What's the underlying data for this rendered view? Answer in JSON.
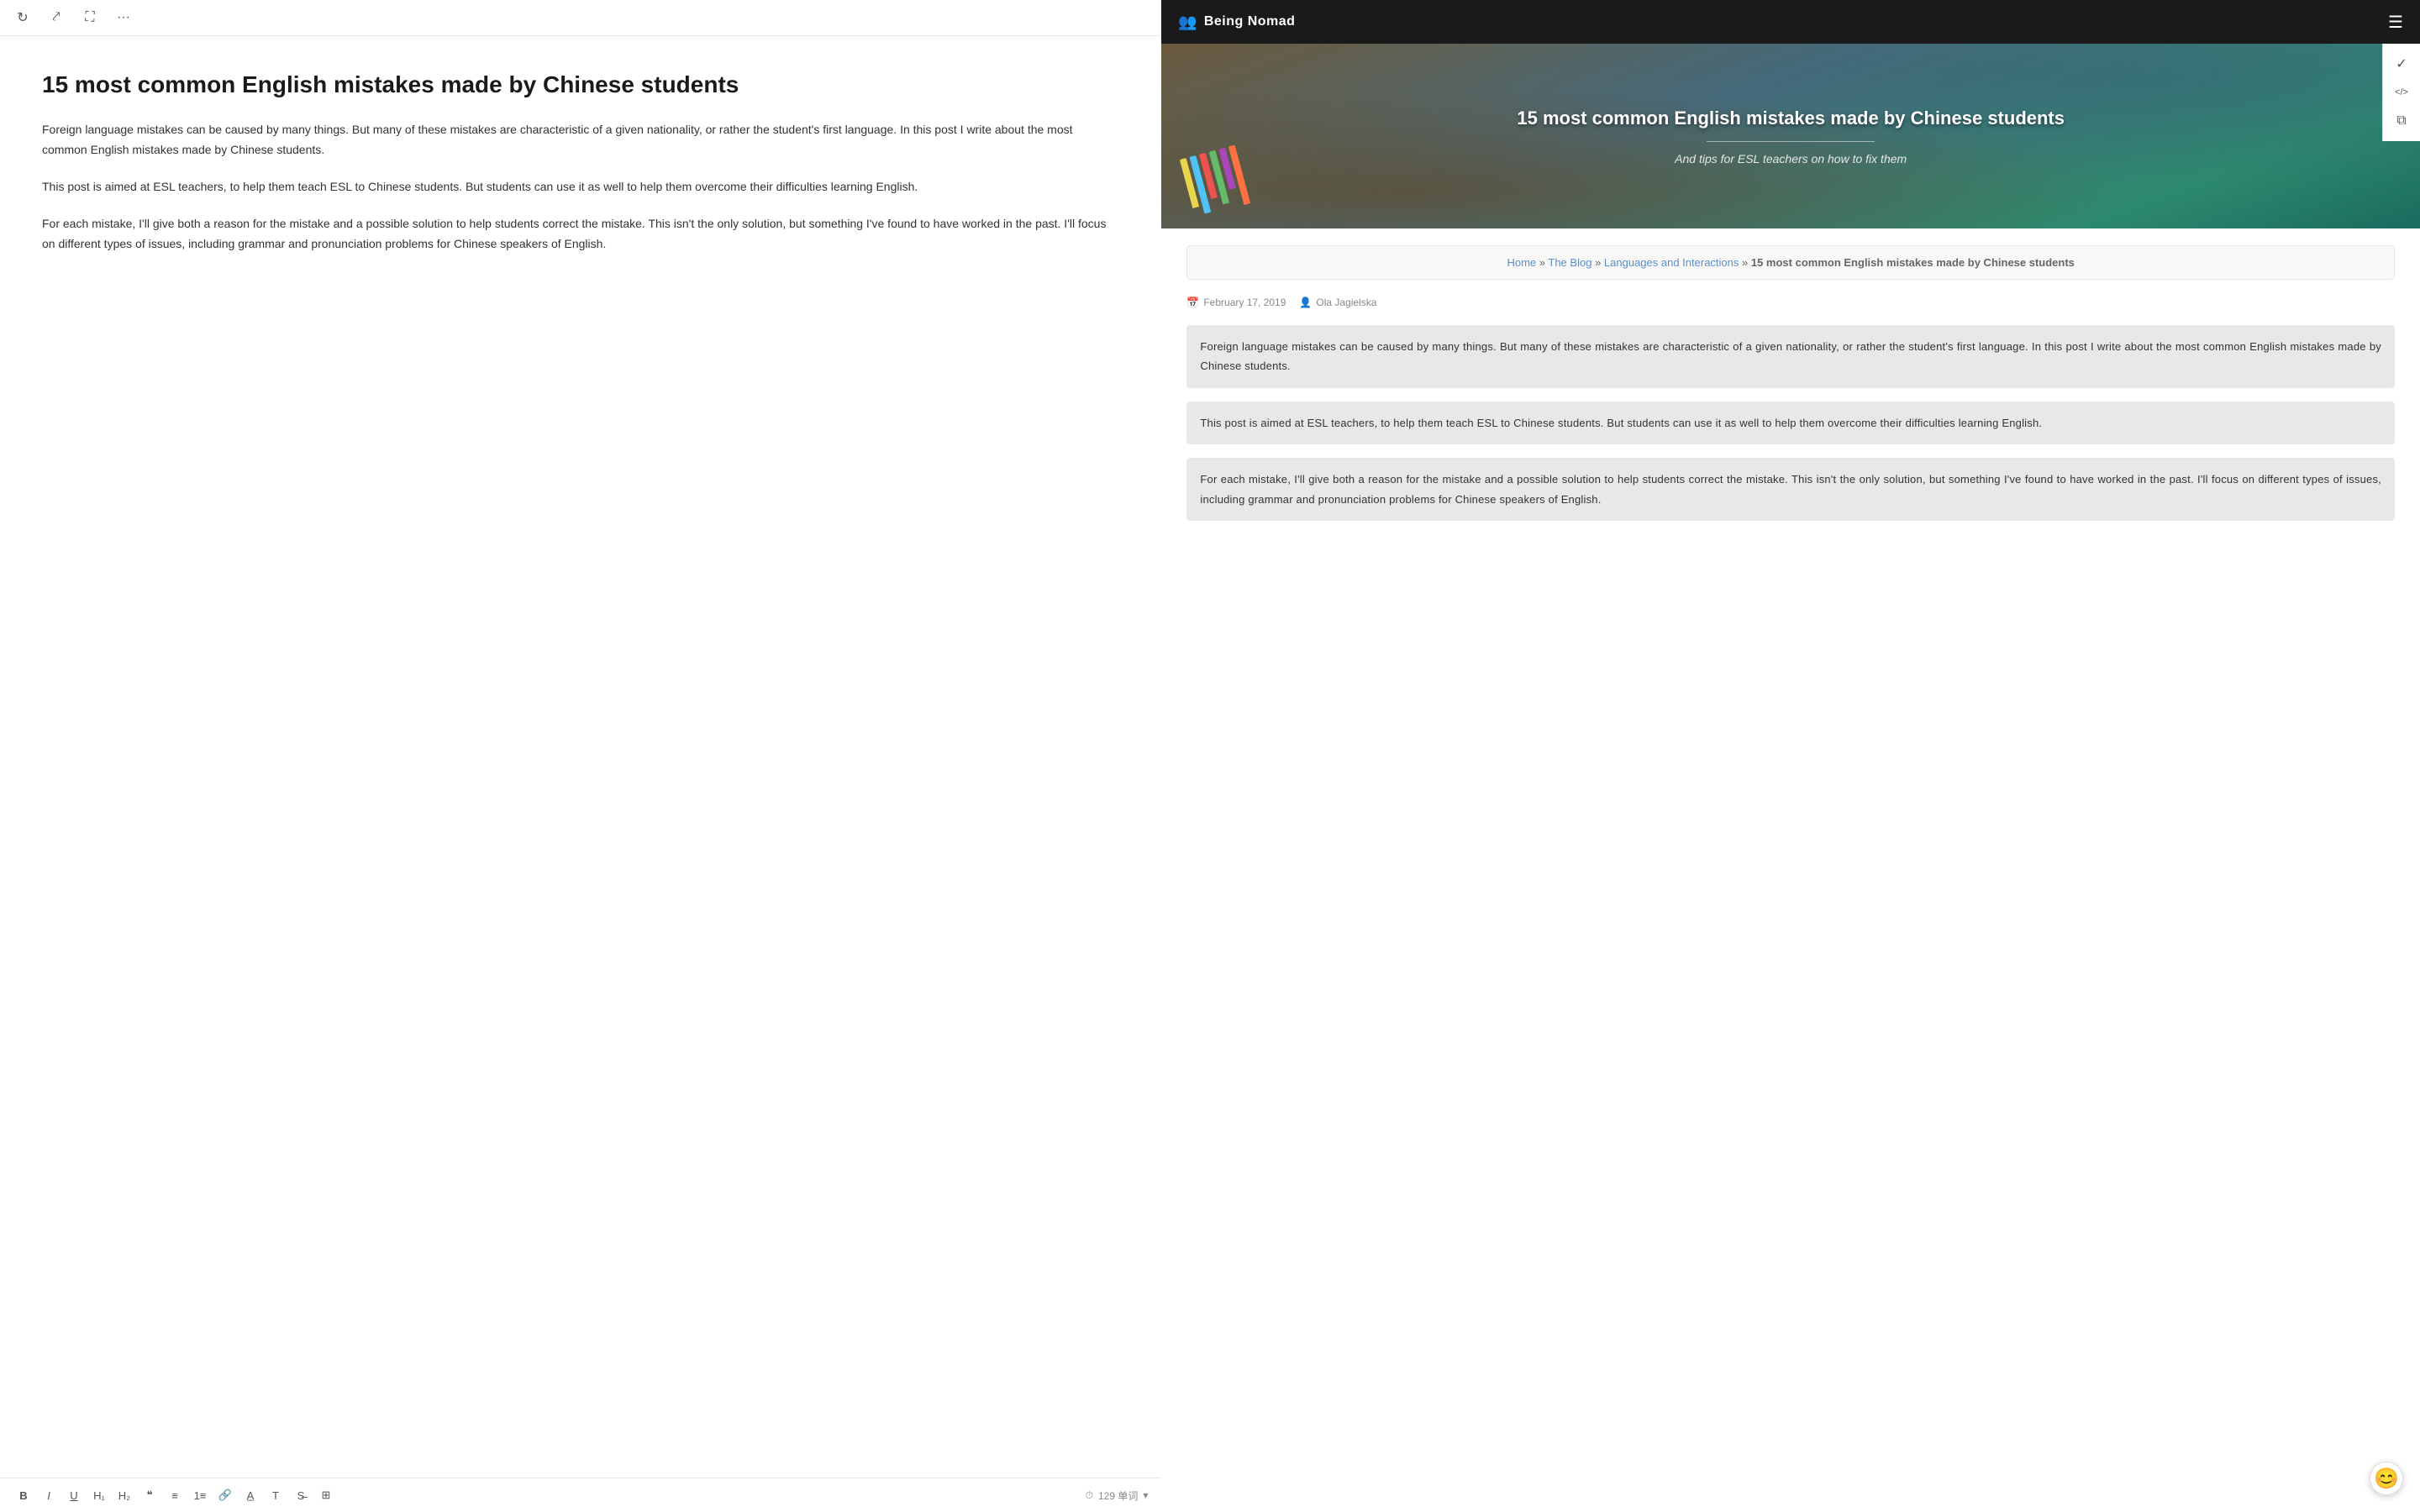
{
  "toolbar": {
    "refresh_icon": "↻",
    "share_icon": "⤤",
    "expand_icon": "⛶",
    "more_icon": "···"
  },
  "editor": {
    "title": "15 most common English mistakes made by Chinese students",
    "paragraphs": [
      "Foreign language mistakes can be caused by many things. But many of these mistakes are characteristic of a given nationality, or rather the student's first language. In this post I write about the most common English mistakes made by Chinese students.",
      "This post is aimed at ESL teachers, to help them teach ESL to Chinese students. But students can use it as well to help them overcome their difficulties learning English.",
      "For each mistake, I'll give both a reason for the mistake and a possible solution to help students correct the mistake. This isn't the only solution, but something I've found to have worked in the past. I'll focus on different types of issues, including grammar and pronunciation problems for Chinese speakers of English."
    ],
    "word_count": "129 单词"
  },
  "bottom_toolbar": {
    "bold": "B",
    "italic": "I",
    "underline": "U",
    "h1": "H₁",
    "h2": "H₂",
    "quote_open": "❝",
    "list_ul": "≡",
    "list_ol": "1≡",
    "link": "🔗",
    "underline2": "A̲",
    "font": "T",
    "strike": "S̶",
    "table": "⊞",
    "clock_icon": "⏱",
    "word_count_label": "129 单词",
    "chevron": "▾"
  },
  "site": {
    "logo": "Being Nomad",
    "logo_icon": "👥",
    "hamburger": "☰"
  },
  "hero": {
    "title": "15 most common English mistakes made by Chinese students",
    "divider": true,
    "subtitle": "And tips for ESL teachers on how to fix them"
  },
  "breadcrumb": {
    "home": "Home",
    "blog": "The Blog",
    "category": "Languages and Interactions",
    "current": "15 most common English mistakes made by Chinese students",
    "sep": "»"
  },
  "article": {
    "date_icon": "📅",
    "date": "February 17, 2019",
    "author_icon": "👤",
    "author": "Ola Jagielska",
    "paragraphs": [
      "Foreign language mistakes can be caused by many things. But many of these mistakes are characteristic of a given nationality, or rather the student's first language. In this post I write about the most common English mistakes made by Chinese students.",
      "This post is aimed at ESL teachers, to help them teach ESL to Chinese students. But students can use it as well to help them overcome their difficulties learning English.",
      "For each mistake, I'll give both a reason for the mistake and a possible solution to help students correct the mistake. This isn't the only solution, but something I've found to have worked in the past. I'll focus on different types of issues, including grammar and pronunciation problems for Chinese speakers of English."
    ]
  },
  "side_icons": {
    "check": "✓",
    "code": "</>",
    "tray": "⧉"
  },
  "emoji_btn": "😊",
  "pencils": [
    {
      "color": "#e8d44d"
    },
    {
      "color": "#4fc3f7"
    },
    {
      "color": "#ef5350"
    },
    {
      "color": "#66bb6a"
    },
    {
      "color": "#ab47bc"
    },
    {
      "color": "#ff7043"
    }
  ]
}
